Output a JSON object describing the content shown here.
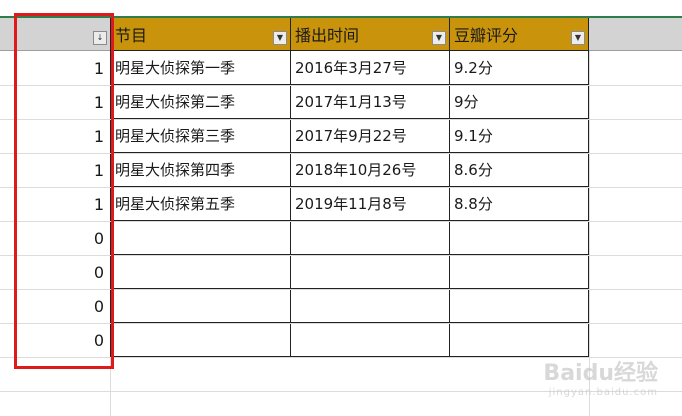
{
  "headers": [
    "节目",
    "播出时间",
    "豆瓣评分"
  ],
  "col_a_filter_icon": "sort-filter-icon",
  "rows": [
    {
      "flag": "1",
      "program": "明星大侦探第一季",
      "air_date": "2016年3月27号",
      "rating": "9.2分"
    },
    {
      "flag": "1",
      "program": "明星大侦探第二季",
      "air_date": "2017年1月13号",
      "rating": "9分"
    },
    {
      "flag": "1",
      "program": "明星大侦探第三季",
      "air_date": "2017年9月22号",
      "rating": "9.1分"
    },
    {
      "flag": "1",
      "program": "明星大侦探第四季",
      "air_date": "2018年10月26号",
      "rating": "8.6分"
    },
    {
      "flag": "1",
      "program": "明星大侦探第五季",
      "air_date": "2019年11月8号",
      "rating": "8.8分"
    },
    {
      "flag": "0",
      "program": "",
      "air_date": "",
      "rating": ""
    },
    {
      "flag": "0",
      "program": "",
      "air_date": "",
      "rating": ""
    },
    {
      "flag": "0",
      "program": "",
      "air_date": "",
      "rating": ""
    },
    {
      "flag": "0",
      "program": "",
      "air_date": "",
      "rating": ""
    }
  ],
  "watermark": {
    "text": "Baidu经验",
    "sub": "jingyan.baidu.com"
  },
  "colors": {
    "header_fill": "#c9940b",
    "highlight_border": "#e0191b",
    "top_line": "#2f7d4a"
  }
}
